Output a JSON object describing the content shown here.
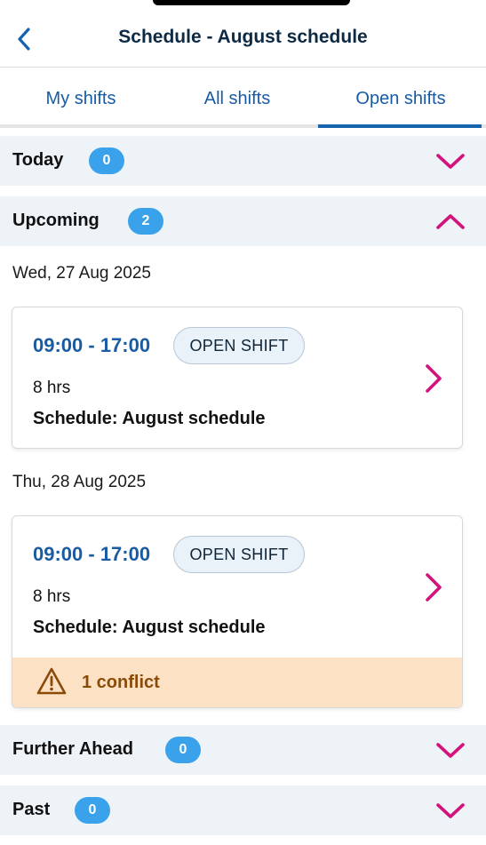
{
  "header": {
    "title": "Schedule - August schedule"
  },
  "tabs": [
    {
      "label": "My shifts"
    },
    {
      "label": "All shifts"
    },
    {
      "label": "Open shifts"
    }
  ],
  "sections": {
    "today": {
      "label": "Today",
      "count": "0",
      "expanded": false
    },
    "upcoming": {
      "label": "Upcoming",
      "count": "2",
      "expanded": true
    },
    "further_ahead": {
      "label": "Further Ahead",
      "count": "0",
      "expanded": false
    },
    "past": {
      "label": "Past",
      "count": "0",
      "expanded": false
    }
  },
  "shifts": [
    {
      "date": "Wed, 27 Aug 2025",
      "time": "09:00 - 17:00",
      "tag": "OPEN SHIFT",
      "hours": "8 hrs",
      "schedule": "Schedule: August schedule"
    },
    {
      "date": "Thu, 28 Aug 2025",
      "time": "09:00 - 17:00",
      "tag": "OPEN SHIFT",
      "hours": "8 hrs",
      "schedule": "Schedule: August schedule",
      "conflict": "1 conflict"
    }
  ],
  "colors": {
    "accent_blue": "#1664ad",
    "chevron_pink": "#d3137c",
    "badge_blue": "#3aa2ea",
    "conflict_bg": "#fde1c4",
    "conflict_text": "#8a4b08"
  },
  "icons": {
    "back": "chevron-left-icon",
    "expand": "chevron-down-icon",
    "collapse": "chevron-up-icon",
    "open_shift": "chevron-right-icon",
    "warning": "warning-triangle-icon"
  }
}
